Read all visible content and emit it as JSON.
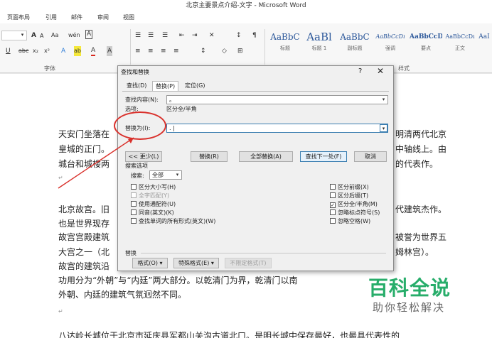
{
  "window": {
    "title": "北京主要景点介绍-文字 - Microsoft Word"
  },
  "ribbon_tabs": [
    "页面布局",
    "引用",
    "邮件",
    "审阅",
    "视图"
  ],
  "ribbon": {
    "font_group_label": "字体",
    "styles_group_label": "样式",
    "row1_glyphs": [
      "A",
      "A",
      "Aa",
      "wén",
      "A"
    ],
    "row2_glyphs": [
      "U",
      "abc",
      "x₂",
      "x²",
      "A",
      "ab",
      "A",
      "A"
    ],
    "styles": [
      {
        "preview": "AaBbC",
        "name": "标题"
      },
      {
        "preview": "AaBl",
        "name": "标题 1"
      },
      {
        "preview": "AaBbC",
        "name": "副标题"
      },
      {
        "preview": "AaBbCcDı",
        "name": "强调"
      },
      {
        "preview": "AaBbCcD",
        "name": "要点"
      },
      {
        "preview": "AaBbCcDı",
        "name": "正文"
      },
      {
        "preview": "AaI",
        "name": ""
      }
    ]
  },
  "document": {
    "lines": [
      "天安门坐落在",
      "皇城的正门。",
      "城台和城楼两",
      "北京故宫。旧",
      "也是世界现存",
      "故宫宫殿建筑",
      "大宫之一（北",
      "故宫的建筑沿",
      "功用分为“外朝”与“内廷”两大部分。以乾清门为界，乾清门以南",
      "外朝、内廷的建筑气氛迥然不同。"
    ],
    "right_fragments": [
      "明清两代北京",
      "中轴线上。由",
      "的代表作。",
      "代建筑杰作。",
      "被誉为世界五",
      "姆林宫）。"
    ],
    "paragraph_mark": "↵",
    "last_line": "八达岭长城位于北京市延庆县军都山关沟古道北口。是明长城中保存最好，也最具代表性的"
  },
  "dialog": {
    "title": "查找和替换",
    "help": "?",
    "close": "✕",
    "tabs": [
      "查找(D)",
      "替换(P)",
      "定位(G)"
    ],
    "find_label": "查找内容(N):",
    "find_value": "。",
    "options_label": "选项:",
    "options_value": "区分全/半角",
    "replace_label": "替换为(I):",
    "replace_value": ". |",
    "buttons": {
      "less": "<< 更少(L)",
      "replace": "替换(R)",
      "replace_all": "全部替换(A)",
      "find_next": "查找下一处(F)",
      "cancel": "取消"
    },
    "search_options_title": "搜索选项",
    "search_label": "搜索:",
    "search_value": "全部",
    "checks_left": [
      {
        "label": "区分大小写(H)",
        "checked": false,
        "disabled": false
      },
      {
        "label": "全字匹配(Y)",
        "checked": false,
        "disabled": true
      },
      {
        "label": "使用通配符(U)",
        "checked": false,
        "disabled": false
      },
      {
        "label": "同音(英文)(K)",
        "checked": false,
        "disabled": false
      },
      {
        "label": "查找单词的所有形式(英文)(W)",
        "checked": false,
        "disabled": false
      }
    ],
    "checks_right": [
      {
        "label": "区分前缀(X)",
        "checked": false
      },
      {
        "label": "区分后缀(T)",
        "checked": false
      },
      {
        "label": "区分全/半角(M)",
        "checked": true
      },
      {
        "label": "忽略标点符号(S)",
        "checked": false
      },
      {
        "label": "忽略空格(W)",
        "checked": false
      }
    ],
    "replace_section_label": "替换",
    "bottom_buttons": {
      "format": "格式(O) ▾",
      "special": "特殊格式(E) ▾",
      "no_format": "不限定格式(T)"
    }
  },
  "watermark": {
    "main": "百科全说",
    "sub": "助你轻松解决"
  },
  "colors": {
    "annotation_red": "#d9302b",
    "watermark_green": "#27ad6a",
    "accent_blue": "#3c7fb1"
  }
}
